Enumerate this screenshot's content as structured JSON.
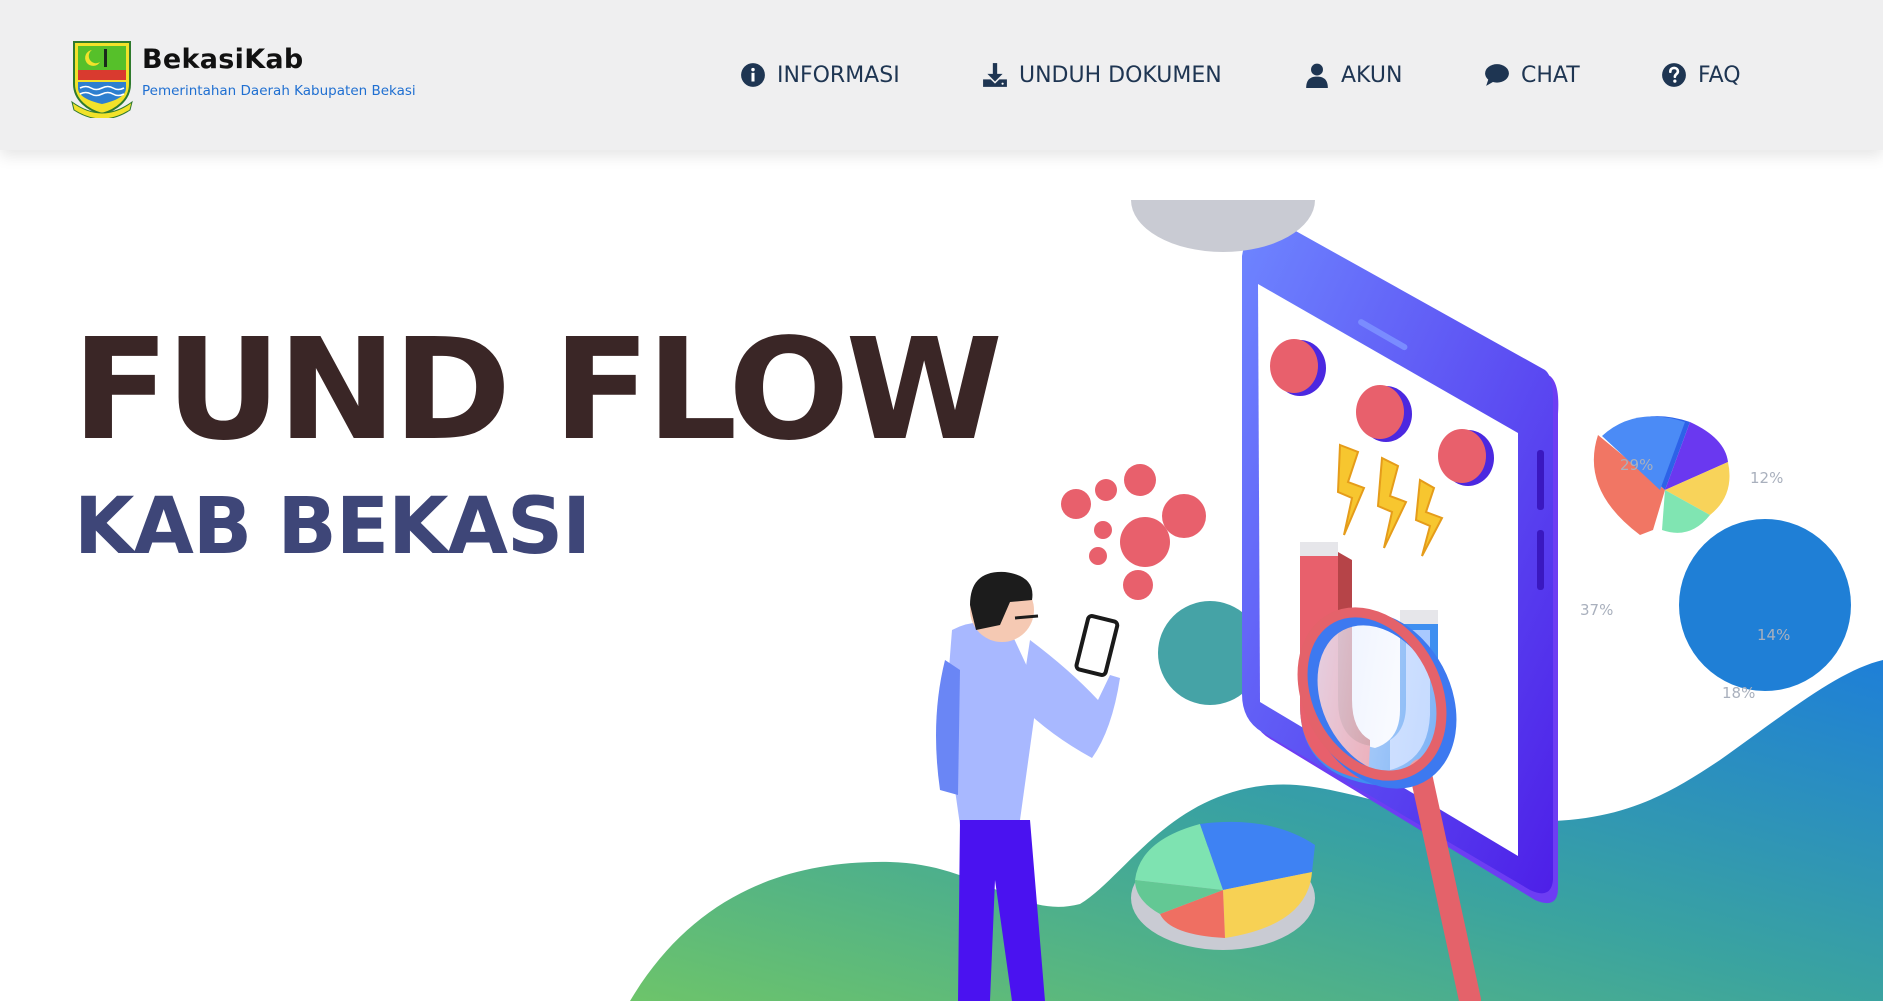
{
  "header": {
    "brand_title": "BekasiKab",
    "brand_subtitle": "Pemerintahan Daerah Kabupaten Bekasi",
    "logo_icon": "bekasi-regency-emblem",
    "nav": [
      {
        "label": "INFORMASI",
        "icon": "info-circle-icon"
      },
      {
        "label": "UNDUH DOKUMEN",
        "icon": "download-icon"
      },
      {
        "label": "AKUN",
        "icon": "user-icon"
      },
      {
        "label": "CHAT",
        "icon": "chat-bubble-icon"
      },
      {
        "label": "FAQ",
        "icon": "question-circle-icon"
      }
    ]
  },
  "hero": {
    "title": "FUND FLOW",
    "subtitle": "KAB BEKASI"
  },
  "illustration": {
    "pie_labels": [
      "29%",
      "12%",
      "37%",
      "14%",
      "18%"
    ]
  },
  "colors": {
    "header_bg": "#efeff0",
    "nav_text": "#1e3552",
    "brand_sub": "#1f6fd1",
    "title": "#3a2626",
    "subtitle": "#3e4678",
    "phone": "#5b3cf5",
    "wave_blue": "#2a7fd4",
    "wave_green": "#6cc26a"
  }
}
